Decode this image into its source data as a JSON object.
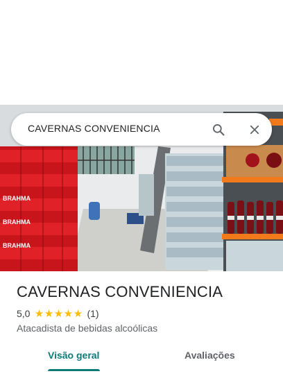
{
  "search": {
    "query": "CAVERNAS CONVENIENCIA"
  },
  "photo": {
    "brand_lettering": "BRAHMA"
  },
  "place": {
    "name": "CAVERNAS CONVENIENCIA",
    "rating": "5,0",
    "stars": 5,
    "review_count": "(1)",
    "category": "Atacadista de bebidas alcoólicas"
  },
  "tabs": [
    {
      "label": "Visão geral",
      "active": true
    },
    {
      "label": "Avaliações",
      "active": false
    }
  ],
  "colors": {
    "accent": "#0b7a78",
    "star": "#fbbc04"
  }
}
